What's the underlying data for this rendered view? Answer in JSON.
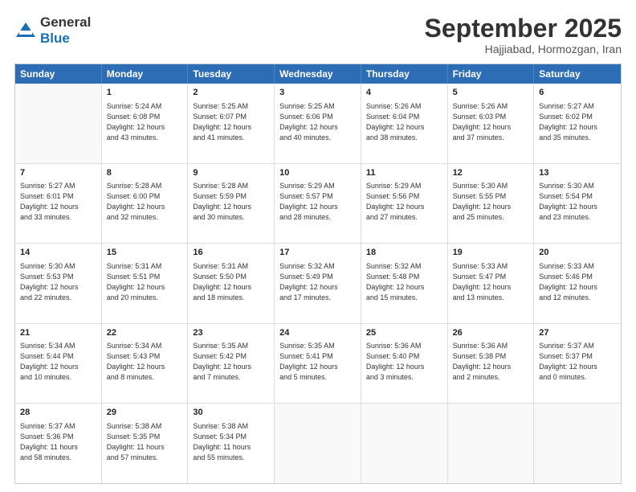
{
  "header": {
    "logo_line1": "General",
    "logo_line2": "Blue",
    "month": "September 2025",
    "location": "Hajjiabad, Hormozgan, Iran"
  },
  "weekdays": [
    "Sunday",
    "Monday",
    "Tuesday",
    "Wednesday",
    "Thursday",
    "Friday",
    "Saturday"
  ],
  "rows": [
    [
      {
        "day": "",
        "text": ""
      },
      {
        "day": "1",
        "text": "Sunrise: 5:24 AM\nSunset: 6:08 PM\nDaylight: 12 hours\nand 43 minutes."
      },
      {
        "day": "2",
        "text": "Sunrise: 5:25 AM\nSunset: 6:07 PM\nDaylight: 12 hours\nand 41 minutes."
      },
      {
        "day": "3",
        "text": "Sunrise: 5:25 AM\nSunset: 6:06 PM\nDaylight: 12 hours\nand 40 minutes."
      },
      {
        "day": "4",
        "text": "Sunrise: 5:26 AM\nSunset: 6:04 PM\nDaylight: 12 hours\nand 38 minutes."
      },
      {
        "day": "5",
        "text": "Sunrise: 5:26 AM\nSunset: 6:03 PM\nDaylight: 12 hours\nand 37 minutes."
      },
      {
        "day": "6",
        "text": "Sunrise: 5:27 AM\nSunset: 6:02 PM\nDaylight: 12 hours\nand 35 minutes."
      }
    ],
    [
      {
        "day": "7",
        "text": "Sunrise: 5:27 AM\nSunset: 6:01 PM\nDaylight: 12 hours\nand 33 minutes."
      },
      {
        "day": "8",
        "text": "Sunrise: 5:28 AM\nSunset: 6:00 PM\nDaylight: 12 hours\nand 32 minutes."
      },
      {
        "day": "9",
        "text": "Sunrise: 5:28 AM\nSunset: 5:59 PM\nDaylight: 12 hours\nand 30 minutes."
      },
      {
        "day": "10",
        "text": "Sunrise: 5:29 AM\nSunset: 5:57 PM\nDaylight: 12 hours\nand 28 minutes."
      },
      {
        "day": "11",
        "text": "Sunrise: 5:29 AM\nSunset: 5:56 PM\nDaylight: 12 hours\nand 27 minutes."
      },
      {
        "day": "12",
        "text": "Sunrise: 5:30 AM\nSunset: 5:55 PM\nDaylight: 12 hours\nand 25 minutes."
      },
      {
        "day": "13",
        "text": "Sunrise: 5:30 AM\nSunset: 5:54 PM\nDaylight: 12 hours\nand 23 minutes."
      }
    ],
    [
      {
        "day": "14",
        "text": "Sunrise: 5:30 AM\nSunset: 5:53 PM\nDaylight: 12 hours\nand 22 minutes."
      },
      {
        "day": "15",
        "text": "Sunrise: 5:31 AM\nSunset: 5:51 PM\nDaylight: 12 hours\nand 20 minutes."
      },
      {
        "day": "16",
        "text": "Sunrise: 5:31 AM\nSunset: 5:50 PM\nDaylight: 12 hours\nand 18 minutes."
      },
      {
        "day": "17",
        "text": "Sunrise: 5:32 AM\nSunset: 5:49 PM\nDaylight: 12 hours\nand 17 minutes."
      },
      {
        "day": "18",
        "text": "Sunrise: 5:32 AM\nSunset: 5:48 PM\nDaylight: 12 hours\nand 15 minutes."
      },
      {
        "day": "19",
        "text": "Sunrise: 5:33 AM\nSunset: 5:47 PM\nDaylight: 12 hours\nand 13 minutes."
      },
      {
        "day": "20",
        "text": "Sunrise: 5:33 AM\nSunset: 5:46 PM\nDaylight: 12 hours\nand 12 minutes."
      }
    ],
    [
      {
        "day": "21",
        "text": "Sunrise: 5:34 AM\nSunset: 5:44 PM\nDaylight: 12 hours\nand 10 minutes."
      },
      {
        "day": "22",
        "text": "Sunrise: 5:34 AM\nSunset: 5:43 PM\nDaylight: 12 hours\nand 8 minutes."
      },
      {
        "day": "23",
        "text": "Sunrise: 5:35 AM\nSunset: 5:42 PM\nDaylight: 12 hours\nand 7 minutes."
      },
      {
        "day": "24",
        "text": "Sunrise: 5:35 AM\nSunset: 5:41 PM\nDaylight: 12 hours\nand 5 minutes."
      },
      {
        "day": "25",
        "text": "Sunrise: 5:36 AM\nSunset: 5:40 PM\nDaylight: 12 hours\nand 3 minutes."
      },
      {
        "day": "26",
        "text": "Sunrise: 5:36 AM\nSunset: 5:38 PM\nDaylight: 12 hours\nand 2 minutes."
      },
      {
        "day": "27",
        "text": "Sunrise: 5:37 AM\nSunset: 5:37 PM\nDaylight: 12 hours\nand 0 minutes."
      }
    ],
    [
      {
        "day": "28",
        "text": "Sunrise: 5:37 AM\nSunset: 5:36 PM\nDaylight: 11 hours\nand 58 minutes."
      },
      {
        "day": "29",
        "text": "Sunrise: 5:38 AM\nSunset: 5:35 PM\nDaylight: 11 hours\nand 57 minutes."
      },
      {
        "day": "30",
        "text": "Sunrise: 5:38 AM\nSunset: 5:34 PM\nDaylight: 11 hours\nand 55 minutes."
      },
      {
        "day": "",
        "text": ""
      },
      {
        "day": "",
        "text": ""
      },
      {
        "day": "",
        "text": ""
      },
      {
        "day": "",
        "text": ""
      }
    ]
  ]
}
